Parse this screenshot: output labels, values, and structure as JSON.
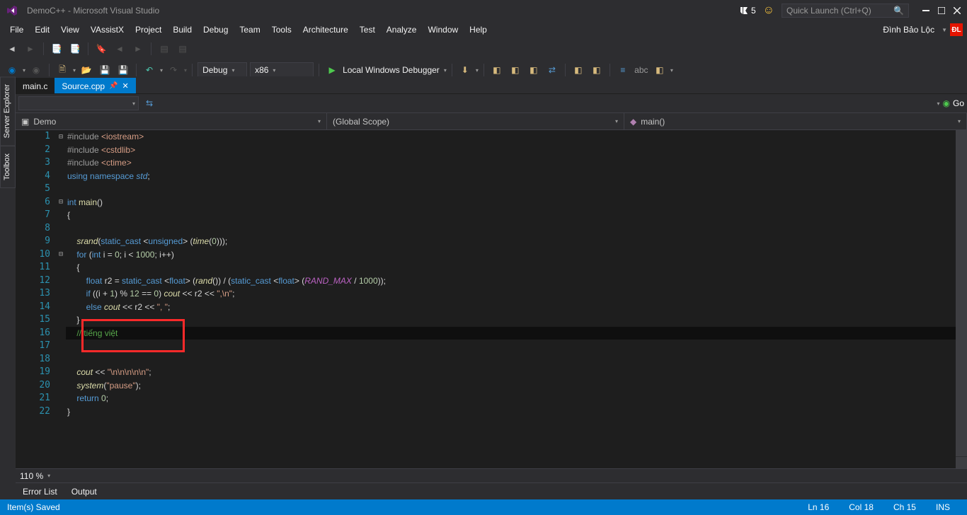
{
  "title": "DemoC++ - Microsoft Visual Studio",
  "flag_count": "5",
  "quick_launch_placeholder": "Quick Launch (Ctrl+Q)",
  "menu": [
    "File",
    "Edit",
    "View",
    "VAssistX",
    "Project",
    "Build",
    "Debug",
    "Team",
    "Tools",
    "Architecture",
    "Test",
    "Analyze",
    "Window",
    "Help"
  ],
  "user_name": "Đình Bảo Lộc",
  "user_initials": "ĐL",
  "toolbar2": {
    "config": "Debug",
    "platform": "x86",
    "debugger_label": "Local Windows Debugger"
  },
  "side_tabs": [
    "Server Explorer",
    "Toolbox"
  ],
  "tabs": [
    {
      "label": "main.c",
      "active": false
    },
    {
      "label": "Source.cpp",
      "active": true
    }
  ],
  "go_label": "Go",
  "scope": {
    "project": "Demo",
    "namespace": "(Global Scope)",
    "function": "main()"
  },
  "code": {
    "lines": [
      {
        "n": 1,
        "fold": "⊟",
        "tokens": [
          [
            "tk-pre",
            "#include "
          ],
          [
            "tk-string",
            "<iostream>"
          ]
        ]
      },
      {
        "n": 2,
        "fold": "",
        "tokens": [
          [
            "tk-pre",
            "#include "
          ],
          [
            "tk-string",
            "<cstdlib>"
          ]
        ]
      },
      {
        "n": 3,
        "fold": "",
        "tokens": [
          [
            "tk-pre",
            "#include "
          ],
          [
            "tk-string",
            "<ctime>"
          ]
        ]
      },
      {
        "n": 4,
        "fold": "",
        "tokens": [
          [
            "tk-kw",
            "using "
          ],
          [
            "tk-kw",
            "namespace "
          ],
          [
            "tk-type tk-ns",
            "std"
          ],
          [
            "tk-op",
            ";"
          ]
        ]
      },
      {
        "n": 5,
        "fold": "",
        "tokens": []
      },
      {
        "n": 6,
        "fold": "⊟",
        "tokens": [
          [
            "tk-kw",
            "int "
          ],
          [
            "tk-funcn",
            "main"
          ],
          [
            "tk-op",
            "()"
          ]
        ]
      },
      {
        "n": 7,
        "fold": "",
        "tokens": [
          [
            "tk-op",
            "{"
          ]
        ]
      },
      {
        "n": 8,
        "fold": "",
        "tokens": []
      },
      {
        "n": 9,
        "fold": "",
        "tokens": [
          [
            "tk-ident",
            "    "
          ],
          [
            "tk-func",
            "srand"
          ],
          [
            "tk-op",
            "("
          ],
          [
            "tk-kw",
            "static_cast"
          ],
          [
            "tk-op",
            " <"
          ],
          [
            "tk-kw",
            "unsigned"
          ],
          [
            "tk-op",
            "> ("
          ],
          [
            "tk-func",
            "time"
          ],
          [
            "tk-op",
            "("
          ],
          [
            "tk-num",
            "0"
          ],
          [
            "tk-op",
            ")));"
          ]
        ]
      },
      {
        "n": 10,
        "fold": "⊟",
        "tokens": [
          [
            "tk-ident",
            "    "
          ],
          [
            "tk-kw",
            "for"
          ],
          [
            "tk-op",
            " ("
          ],
          [
            "tk-kw",
            "int"
          ],
          [
            "tk-ident",
            " i "
          ],
          [
            "tk-op",
            "= "
          ],
          [
            "tk-num",
            "0"
          ],
          [
            "tk-op",
            "; i < "
          ],
          [
            "tk-num",
            "1000"
          ],
          [
            "tk-op",
            "; i++)"
          ]
        ]
      },
      {
        "n": 11,
        "fold": "",
        "tokens": [
          [
            "tk-ident",
            "    "
          ],
          [
            "tk-op",
            "{"
          ]
        ]
      },
      {
        "n": 12,
        "fold": "",
        "tokens": [
          [
            "tk-ident",
            "        "
          ],
          [
            "tk-kw",
            "float"
          ],
          [
            "tk-ident",
            " r2 "
          ],
          [
            "tk-op",
            "= "
          ],
          [
            "tk-kw",
            "static_cast"
          ],
          [
            "tk-op",
            " <"
          ],
          [
            "tk-kw",
            "float"
          ],
          [
            "tk-op",
            "> ("
          ],
          [
            "tk-func",
            "rand"
          ],
          [
            "tk-op",
            "()) / ("
          ],
          [
            "tk-kw",
            "static_cast"
          ],
          [
            "tk-op",
            " <"
          ],
          [
            "tk-kw",
            "float"
          ],
          [
            "tk-op",
            "> ("
          ],
          [
            "tk-macro",
            "RAND_MAX"
          ],
          [
            "tk-op",
            " / "
          ],
          [
            "tk-num",
            "1000"
          ],
          [
            "tk-op",
            "));"
          ]
        ]
      },
      {
        "n": 13,
        "fold": "",
        "tokens": [
          [
            "tk-ident",
            "        "
          ],
          [
            "tk-kw",
            "if"
          ],
          [
            "tk-op",
            " ((i + "
          ],
          [
            "tk-num",
            "1"
          ],
          [
            "tk-op",
            ") % "
          ],
          [
            "tk-num",
            "12"
          ],
          [
            "tk-op",
            " == "
          ],
          [
            "tk-num",
            "0"
          ],
          [
            "tk-op",
            ") "
          ],
          [
            "tk-func",
            "cout"
          ],
          [
            "tk-op",
            " << r2 << "
          ],
          [
            "tk-string",
            "\",\\n\""
          ],
          [
            "tk-op",
            ";"
          ]
        ]
      },
      {
        "n": 14,
        "fold": "",
        "tokens": [
          [
            "tk-ident",
            "        "
          ],
          [
            "tk-kw",
            "else"
          ],
          [
            "tk-ident",
            " "
          ],
          [
            "tk-func",
            "cout"
          ],
          [
            "tk-op",
            " << r2 << "
          ],
          [
            "tk-string",
            "\", \""
          ],
          [
            "tk-op",
            ";"
          ]
        ]
      },
      {
        "n": 15,
        "fold": "",
        "tokens": [
          [
            "tk-ident",
            "    "
          ],
          [
            "tk-op",
            "}"
          ]
        ]
      },
      {
        "n": 16,
        "fold": "",
        "current": true,
        "tokens": [
          [
            "tk-ident",
            "    "
          ],
          [
            "tk-comment",
            "// tiếng việt"
          ]
        ]
      },
      {
        "n": 17,
        "fold": "",
        "tokens": []
      },
      {
        "n": 18,
        "fold": "",
        "tokens": []
      },
      {
        "n": 19,
        "fold": "",
        "tokens": [
          [
            "tk-ident",
            "    "
          ],
          [
            "tk-func",
            "cout"
          ],
          [
            "tk-op",
            " << "
          ],
          [
            "tk-string",
            "\"\\n\\n\\n\\n\\n\""
          ],
          [
            "tk-op",
            ";"
          ]
        ]
      },
      {
        "n": 20,
        "fold": "",
        "tokens": [
          [
            "tk-ident",
            "    "
          ],
          [
            "tk-func",
            "system"
          ],
          [
            "tk-op",
            "("
          ],
          [
            "tk-string",
            "\"pause\""
          ],
          [
            "tk-op",
            ");"
          ]
        ]
      },
      {
        "n": 21,
        "fold": "",
        "tokens": [
          [
            "tk-ident",
            "    "
          ],
          [
            "tk-kw",
            "return"
          ],
          [
            "tk-op",
            " "
          ],
          [
            "tk-num",
            "0"
          ],
          [
            "tk-op",
            ";"
          ]
        ]
      },
      {
        "n": 22,
        "fold": "",
        "tokens": [
          [
            "tk-op",
            "}"
          ]
        ]
      }
    ]
  },
  "zoom": "110 %",
  "bottom_tabs": [
    "Error List",
    "Output"
  ],
  "status": {
    "left": "Item(s) Saved",
    "ln": "Ln 16",
    "col": "Col 18",
    "ch": "Ch 15",
    "mode": "INS"
  }
}
